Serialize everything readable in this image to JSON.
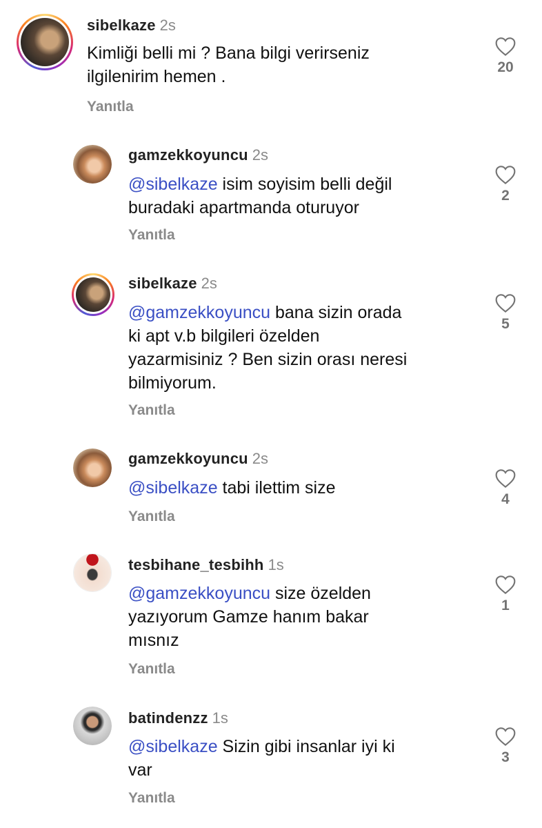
{
  "comments": [
    {
      "username": "sibelkaze",
      "time": "2s",
      "mention": "",
      "lines": [
        "Kimliği  belli mi ? Bana bilgi verirseniz",
        "ilgilenirim  hemen ."
      ],
      "reply": "Yanıtla",
      "likes": "20",
      "avatar_icon": "avatar-photo-cat"
    },
    {
      "username": "gamzekkoyuncu",
      "time": "2s",
      "mention": "@sibelkaze",
      "lines": [
        " isim soyisim belli değil",
        "buradaki apartmanda oturuyor"
      ],
      "reply": "Yanıtla",
      "likes": "2",
      "avatar_icon": "avatar-photo-woman"
    },
    {
      "username": "sibelkaze",
      "time": "2s",
      "mention": "@gamzekkoyuncu",
      "lines": [
        " bana sizin orada",
        "ki apt v.b bilgileri özelden",
        "yazarmisiniz ? Ben sizin orası neresi",
        "bilmiyorum."
      ],
      "reply": "Yanıtla",
      "likes": "5",
      "avatar_icon": "avatar-photo-cat"
    },
    {
      "username": "gamzekkoyuncu",
      "time": "2s",
      "mention": "@sibelkaze",
      "lines": [
        " tabi ilettim size"
      ],
      "reply": "Yanıtla",
      "likes": "4",
      "avatar_icon": "avatar-photo-woman"
    },
    {
      "username": "tesbihane_tesbihh",
      "time": "1s",
      "mention": "@gamzekkoyuncu",
      "lines": [
        " size özelden",
        "yazıyorum Gamze hanım bakar",
        "mısnız"
      ],
      "reply": "Yanıtla",
      "likes": "1",
      "avatar_icon": "avatar-photo-bracelet"
    },
    {
      "username": "batindenzz",
      "time": "1s",
      "mention": "@sibelkaze",
      "lines": [
        " Sizin gibi insanlar iyi ki",
        "var"
      ],
      "reply": "Yanıtla",
      "likes": "3",
      "avatar_icon": "avatar-photo-man"
    }
  ],
  "colors": {
    "mention": "#3a4fc4",
    "muted": "#8a8a8a"
  }
}
